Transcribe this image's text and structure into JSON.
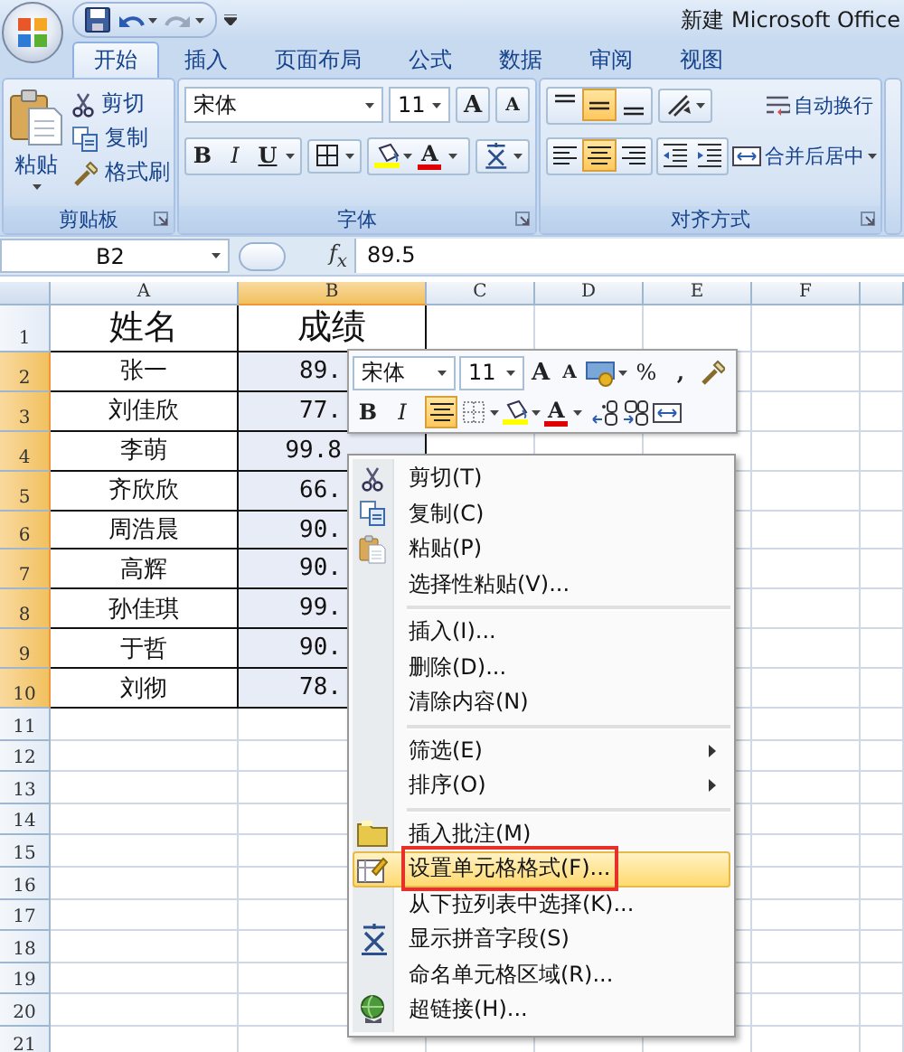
{
  "title_bar": {
    "title": "新建 Microsoft Office"
  },
  "tabs": [
    {
      "label": "开始",
      "selected": true
    },
    {
      "label": "插入",
      "selected": false
    },
    {
      "label": "页面布局",
      "selected": false
    },
    {
      "label": "公式",
      "selected": false
    },
    {
      "label": "数据",
      "selected": false
    },
    {
      "label": "审阅",
      "selected": false
    },
    {
      "label": "视图",
      "selected": false
    }
  ],
  "ribbon": {
    "clipboard": {
      "paste": "粘贴",
      "cut": "剪切",
      "copy": "复制",
      "format_painter": "格式刷",
      "group_label": "剪贴板"
    },
    "font": {
      "font_name": "宋体",
      "font_size": "11",
      "grow_font": "A",
      "shrink_font": "A",
      "bold": "B",
      "italic": "I",
      "underline": "U",
      "font_color": "A",
      "group_label": "字体"
    },
    "alignment": {
      "vertical": [
        {
          "selected": false
        },
        {
          "selected": true
        },
        {
          "selected": false
        }
      ],
      "horizontal": [
        {
          "selected": false
        },
        {
          "selected": true
        },
        {
          "selected": false
        }
      ],
      "wrap_text": "自动换行",
      "merge_center": "合并后居中",
      "group_label": "对齐方式"
    }
  },
  "formula_bar": {
    "name_box": "B2",
    "fx": "f$_{x}$",
    "value": "89.5"
  },
  "sheet": {
    "columns": [
      {
        "label": "A",
        "selected": false
      },
      {
        "label": "B",
        "selected": true
      },
      {
        "label": "C",
        "selected": false
      },
      {
        "label": "D",
        "selected": false
      },
      {
        "label": "E",
        "selected": false
      },
      {
        "label": "F",
        "selected": false
      }
    ],
    "rows": [
      {
        "header": "1",
        "selected": false,
        "kind": "heading",
        "cells": [
          "姓名",
          "成绩"
        ]
      },
      {
        "header": "2",
        "selected": true,
        "kind": "data",
        "cells": [
          "张一",
          "89."
        ]
      },
      {
        "header": "3",
        "selected": true,
        "kind": "data",
        "cells": [
          "刘佳欣",
          "77."
        ]
      },
      {
        "header": "4",
        "selected": true,
        "kind": "data",
        "cells": [
          "李萌",
          "99.8"
        ]
      },
      {
        "header": "5",
        "selected": true,
        "kind": "data",
        "cells": [
          "齐欣欣",
          "66."
        ]
      },
      {
        "header": "6",
        "selected": true,
        "kind": "data",
        "cells": [
          "周浩晨",
          "90."
        ]
      },
      {
        "header": "7",
        "selected": true,
        "kind": "data",
        "cells": [
          "高辉",
          "90."
        ]
      },
      {
        "header": "8",
        "selected": true,
        "kind": "data",
        "cells": [
          "孙佳琪",
          "99."
        ]
      },
      {
        "header": "9",
        "selected": true,
        "kind": "data",
        "cells": [
          "于哲",
          "90."
        ]
      },
      {
        "header": "10",
        "selected": true,
        "kind": "data",
        "cells": [
          "刘彻",
          "78."
        ]
      },
      {
        "header": "11",
        "selected": false,
        "kind": "empty"
      },
      {
        "header": "12",
        "selected": false,
        "kind": "empty"
      },
      {
        "header": "13",
        "selected": false,
        "kind": "empty"
      },
      {
        "header": "14",
        "selected": false,
        "kind": "empty"
      },
      {
        "header": "15",
        "selected": false,
        "kind": "empty"
      },
      {
        "header": "16",
        "selected": false,
        "kind": "empty"
      },
      {
        "header": "17",
        "selected": false,
        "kind": "empty"
      },
      {
        "header": "18",
        "selected": false,
        "kind": "empty"
      },
      {
        "header": "19",
        "selected": false,
        "kind": "empty"
      },
      {
        "header": "20",
        "selected": false,
        "kind": "empty"
      },
      {
        "header": "21",
        "selected": false,
        "kind": "empty"
      }
    ]
  },
  "mini_toolbar": {
    "font_name": "宋体",
    "font_size": "11",
    "grow_font": "A",
    "shrink_font": "A",
    "percent": "%",
    "comma": ",",
    "bold": "B",
    "italic": "I",
    "center": {
      "selected": true
    },
    "font_color": "A"
  },
  "context_menu": {
    "items": [
      {
        "kind": "item",
        "label": "剪切(T)",
        "selected": false
      },
      {
        "kind": "item",
        "label": "复制(C)",
        "selected": false
      },
      {
        "kind": "item",
        "label": "粘贴(P)",
        "selected": false
      },
      {
        "kind": "item",
        "label": "选择性粘贴(V)...",
        "selected": false
      },
      {
        "kind": "separator"
      },
      {
        "kind": "item",
        "label": "插入(I)...",
        "selected": false
      },
      {
        "kind": "item",
        "label": "删除(D)...",
        "selected": false
      },
      {
        "kind": "item",
        "label": "清除内容(N)",
        "selected": false
      },
      {
        "kind": "separator"
      },
      {
        "kind": "submenu",
        "label": "筛选(E)",
        "selected": false
      },
      {
        "kind": "submenu",
        "label": "排序(O)",
        "selected": false
      },
      {
        "kind": "separator"
      },
      {
        "kind": "item",
        "label": "插入批注(M)",
        "selected": false
      },
      {
        "kind": "item",
        "label": "设置单元格格式(F)...",
        "selected": true,
        "annotated": true
      },
      {
        "kind": "item",
        "label": "从下拉列表中选择(K)...",
        "selected": false
      },
      {
        "kind": "item",
        "label": "显示拼音字段(S)",
        "selected": false
      },
      {
        "kind": "item",
        "label": "命名单元格区域(R)...",
        "selected": false
      },
      {
        "kind": "item",
        "label": "超链接(H)...",
        "selected": false
      }
    ]
  }
}
